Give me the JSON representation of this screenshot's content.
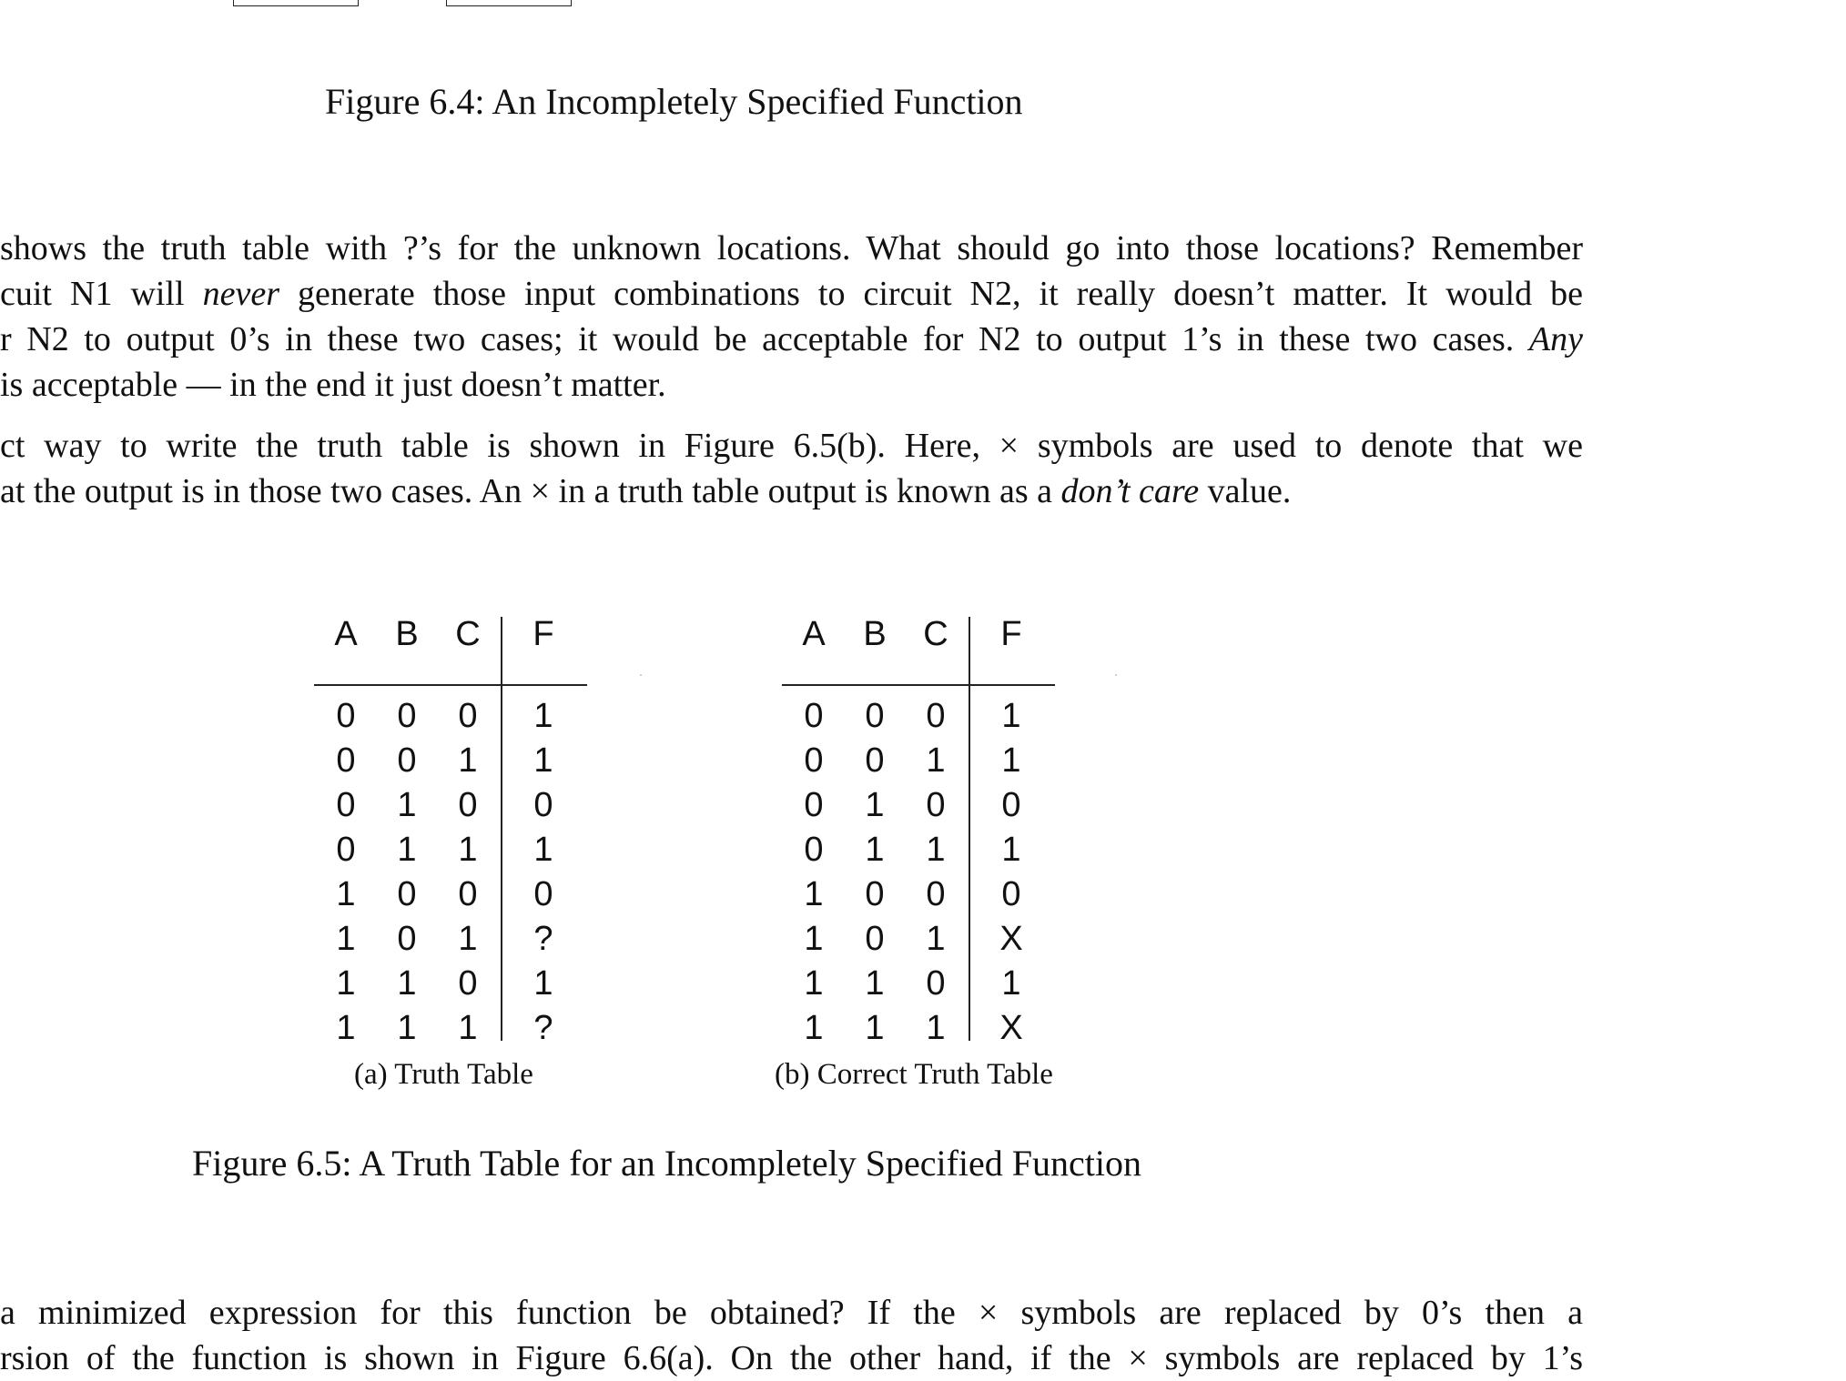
{
  "figure_6_4": {
    "caption": "Figure 6.4: An Incompletely Specified Function"
  },
  "paragraph1": {
    "lines": [
      "shows the truth table with ?’s for the unknown locations. What should go into those locations? Remember",
      "cuit N1 will ",
      "r N2 to output 0’s in these two cases; it would be acceptable for N2 to output 1’s in these two cases. ",
      "is acceptable — in the end it just doesn’t matter."
    ],
    "line2_emphasis": "never",
    "line2_rest": " generate those input combinations to circuit N2, it really doesn’t matter. It would be",
    "line3_emphasis": "Any"
  },
  "paragraph2": {
    "line1": "ct way to write the truth table is shown in Figure 6.5(b). Here, × symbols are used to denote that we",
    "line2_start": "at the output is in those two cases. An × in a truth table output is known as a ",
    "line2_emphasis": "don’t care",
    "line2_end": " value."
  },
  "tables": [
    {
      "headers": [
        "A",
        "B",
        "C",
        "F"
      ],
      "rows": [
        [
          "0",
          "0",
          "0",
          "1"
        ],
        [
          "0",
          "0",
          "1",
          "1"
        ],
        [
          "0",
          "1",
          "0",
          "0"
        ],
        [
          "0",
          "1",
          "1",
          "1"
        ],
        [
          "1",
          "0",
          "0",
          "0"
        ],
        [
          "1",
          "0",
          "1",
          "?"
        ],
        [
          "1",
          "1",
          "0",
          "1"
        ],
        [
          "1",
          "1",
          "1",
          "?"
        ]
      ],
      "caption": "(a)  Truth Table"
    },
    {
      "headers": [
        "A",
        "B",
        "C",
        "F"
      ],
      "rows": [
        [
          "0",
          "0",
          "0",
          "1"
        ],
        [
          "0",
          "0",
          "1",
          "1"
        ],
        [
          "0",
          "1",
          "0",
          "0"
        ],
        [
          "0",
          "1",
          "1",
          "1"
        ],
        [
          "1",
          "0",
          "0",
          "0"
        ],
        [
          "1",
          "0",
          "1",
          "X"
        ],
        [
          "1",
          "1",
          "0",
          "1"
        ],
        [
          "1",
          "1",
          "1",
          "X"
        ]
      ],
      "caption": "(b)  Correct Truth Table"
    }
  ],
  "figure_6_5": {
    "caption": "Figure 6.5: A Truth Table for an Incompletely Specified Function"
  },
  "paragraph3": {
    "line1": "a minimized expression for this function be obtained? If the × symbols are replaced by 0’s then a",
    "line2": "rsion of the function is shown in Figure 6.6(a). On the other hand, if the × symbols are replaced by 1’s"
  }
}
